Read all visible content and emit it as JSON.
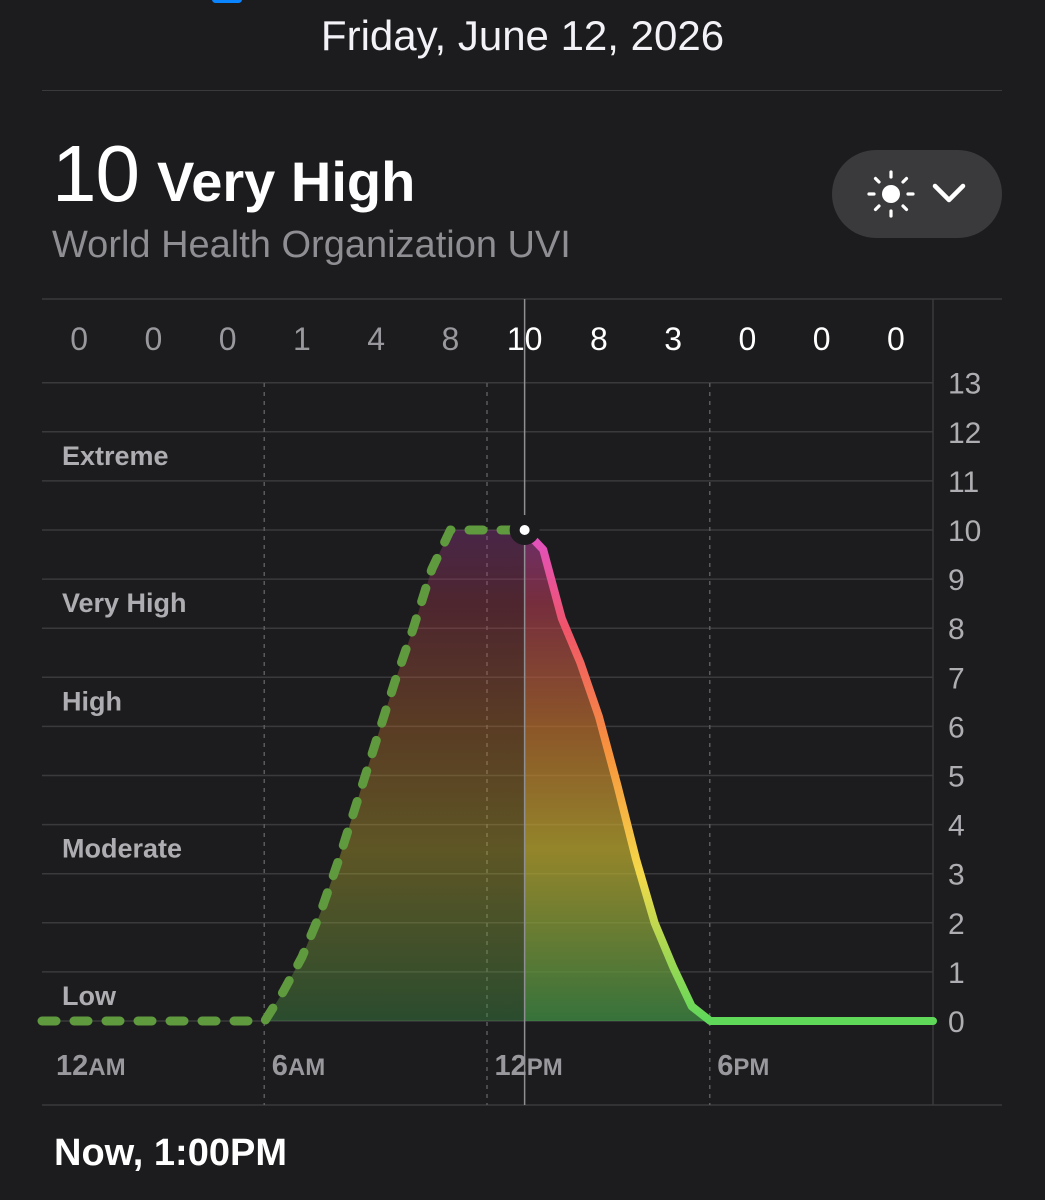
{
  "header": {
    "date": "Friday, June 12, 2026"
  },
  "summary": {
    "value": "10",
    "category": "Very High",
    "source": "World Health Organization UVI"
  },
  "dropdown": {
    "icon": "sun-icon",
    "chevron": "chevron-down-icon"
  },
  "footer": {
    "now_label": "Now, 1:00PM"
  },
  "colors": {
    "background": "#1c1c1e",
    "grid": "#3a3a3c",
    "past_dash": "#5f9a3e",
    "low": "#5fd85a",
    "moderate": "#f5d94a",
    "high": "#f7933d",
    "very_high": "#f0546a",
    "extreme": "#e052c6"
  },
  "chart_data": {
    "type": "area",
    "hourly_labels": [
      {
        "label": "0",
        "hour": 1,
        "past": true
      },
      {
        "label": "0",
        "hour": 3,
        "past": true
      },
      {
        "label": "0",
        "hour": 5,
        "past": true
      },
      {
        "label": "1",
        "hour": 7,
        "past": true
      },
      {
        "label": "4",
        "hour": 9,
        "past": true
      },
      {
        "label": "8",
        "hour": 11,
        "past": true
      },
      {
        "label": "10",
        "hour": 13,
        "past": false
      },
      {
        "label": "8",
        "hour": 15,
        "past": false
      },
      {
        "label": "3",
        "hour": 17,
        "past": false
      },
      {
        "label": "0",
        "hour": 19,
        "past": false
      },
      {
        "label": "0",
        "hour": 21,
        "past": false
      },
      {
        "label": "0",
        "hour": 23,
        "past": false
      }
    ],
    "x_ticks": [
      {
        "hour": 0,
        "num": "12",
        "suffix": "AM"
      },
      {
        "hour": 6,
        "num": "6",
        "suffix": "AM"
      },
      {
        "hour": 12,
        "num": "12",
        "suffix": "PM"
      },
      {
        "hour": 18,
        "num": "6",
        "suffix": "PM"
      }
    ],
    "y_ticks": [
      "0",
      "1",
      "2",
      "3",
      "4",
      "5",
      "6",
      "7",
      "8",
      "9",
      "10",
      "11",
      "12",
      "13"
    ],
    "ylim": [
      0,
      13
    ],
    "xlim": [
      0,
      24
    ],
    "categories": [
      {
        "label": "Low",
        "level": 0
      },
      {
        "label": "Moderate",
        "level": 3
      },
      {
        "label": "High",
        "level": 6
      },
      {
        "label": "Very High",
        "level": 8
      },
      {
        "label": "Extreme",
        "level": 11
      }
    ],
    "series": [
      {
        "points": [
          [
            0,
            0
          ],
          [
            6,
            0
          ],
          [
            6.5,
            0.6
          ],
          [
            7,
            1.3
          ],
          [
            7.5,
            2.2
          ],
          [
            8,
            3.3
          ],
          [
            8.5,
            4.5
          ],
          [
            9,
            5.7
          ],
          [
            9.5,
            6.9
          ],
          [
            10,
            8
          ],
          [
            10.5,
            9.2
          ],
          [
            11,
            10
          ],
          [
            12,
            10
          ],
          [
            13,
            10
          ],
          [
            13.5,
            9.6
          ],
          [
            14,
            8.2
          ],
          [
            14.5,
            7.3
          ],
          [
            15,
            6.2
          ],
          [
            15.5,
            4.8
          ],
          [
            16,
            3.3
          ],
          [
            16.5,
            2
          ],
          [
            17,
            1.1
          ],
          [
            17.5,
            0.3
          ],
          [
            18,
            0
          ],
          [
            24,
            0
          ]
        ]
      }
    ],
    "now_hour": 13,
    "now_value": 10,
    "grid": true
  }
}
